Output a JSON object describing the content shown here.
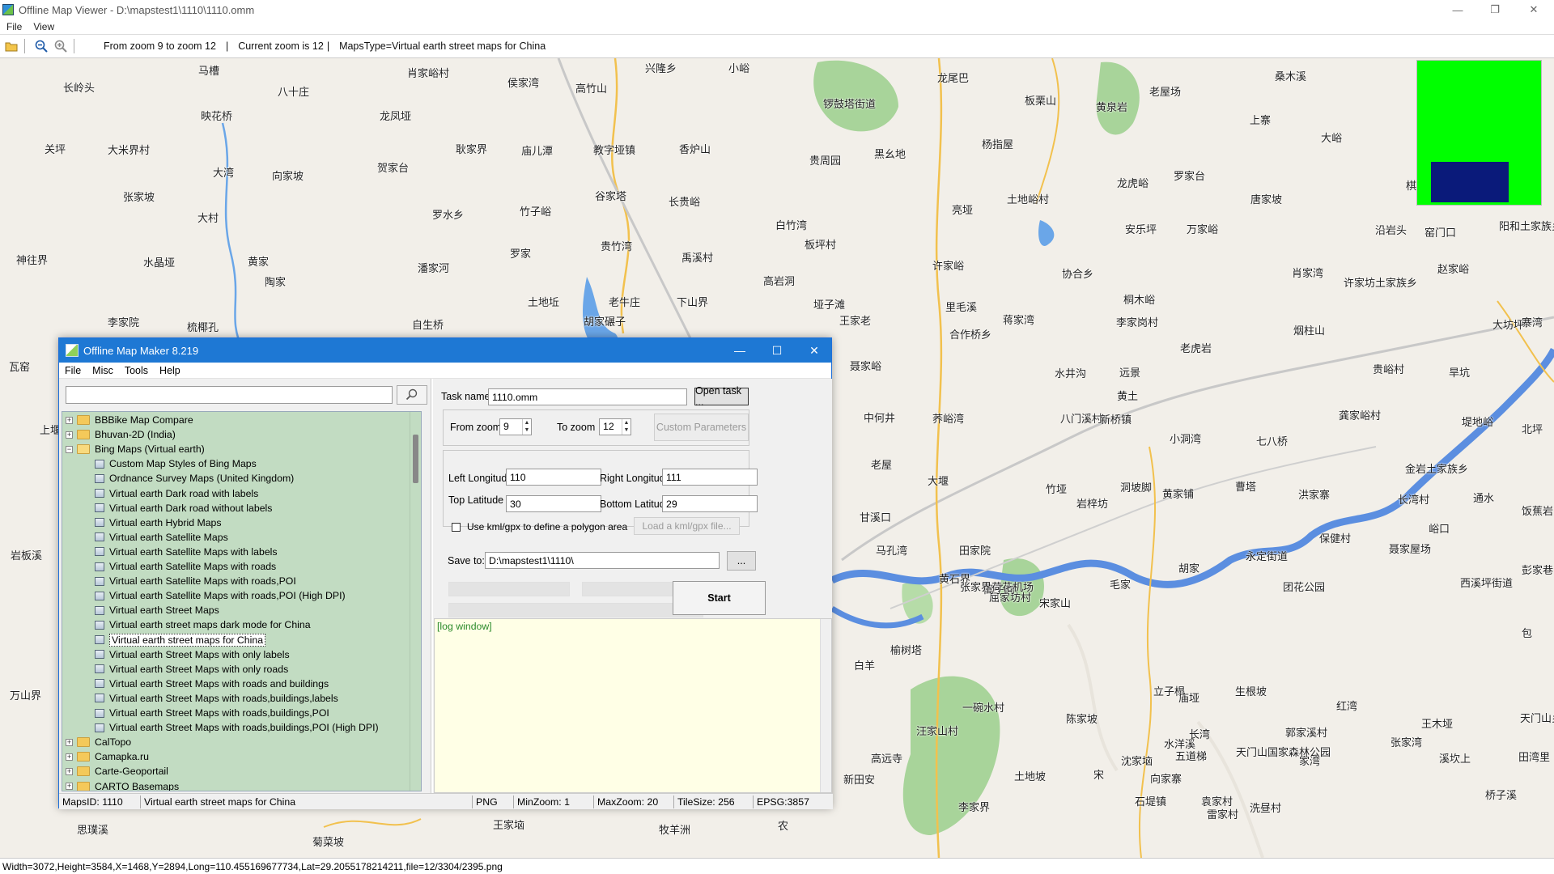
{
  "window": {
    "title": "Offline Map Viewer - D:\\mapstest1\\1110\\1110.omm",
    "controls": {
      "minimize": "—",
      "maximize": "❐",
      "close": "✕"
    }
  },
  "menu": {
    "file": "File",
    "view": "View"
  },
  "toolbar": {
    "zoom_range": "From zoom 9 to zoom 12",
    "current_zoom": "Current zoom is 12",
    "maps_type": "MapsType=Virtual earth street maps for China",
    "separator": "|"
  },
  "statusbar": {
    "text": "Width=3072,Height=3584,X=1468,Y=2894,Long=110.455169677734,Lat=29.2055178214211,file=12/3304/2395.png"
  },
  "colors": {
    "minimap_bg": "#00ff00",
    "minimap_viewport": "#0a1a7a",
    "tree_bg": "#c2dcc2",
    "log_bg": "#ffffe6",
    "dialog_title": "#1e78d4"
  },
  "map_labels": [
    "马槽",
    "肖家峪村",
    "侯家湾",
    "高竹山",
    "兴隆乡",
    "小峪",
    "龙尾巴",
    "长岭头",
    "八十庄",
    "锣鼓塔街道",
    "板栗山",
    "黄泉岩",
    "老屋场",
    "桑木溪",
    "上寨",
    "雷",
    "映花桥",
    "龙凤垭",
    "关坪",
    "大米界村",
    "耿家界",
    "庙儿潭",
    "教字垭镇",
    "香炉山",
    "贵周园",
    "黑幺地",
    "杨指屋",
    "大峪",
    "大湾",
    "向家坡",
    "贺家台",
    "龙虎峪",
    "罗家台",
    "棋盘村",
    "张家坡",
    "谷家塔",
    "长贵峪",
    "土地峪村",
    "唐家坡",
    "罗水乡",
    "竹子峪",
    "亮垭",
    "安乐坪",
    "万家峪",
    "大村",
    "白竹湾",
    "沿岩头",
    "窑门口",
    "阳和土家族乡",
    "神往界",
    "水晶垭",
    "黄家",
    "潘家河",
    "罗家",
    "贵竹湾",
    "禹溪村",
    "板坪村",
    "许家峪",
    "协合乡",
    "肖家湾",
    "赵家峪",
    "陶家",
    "高岩洞",
    "土地坵",
    "老牛庄",
    "下山界",
    "垭子滩",
    "里毛溪",
    "桐木峪",
    "许家坊土家族乡",
    "李家院",
    "梳椰孔",
    "自生桥",
    "胡家碾子",
    "王家老",
    "蒋家湾",
    "李家岗村",
    "大坊坪",
    "寨湾",
    "瓦窑",
    "烟柱山",
    "老虎岩",
    "合作桥乡",
    "聂家峪",
    "水井沟",
    "远景",
    "贵峪村",
    "旱坑",
    "上堰溃",
    "黄土",
    "中何井",
    "荞峪湾",
    "八门溪村",
    "新桥镇",
    "小洞湾",
    "七八桥",
    "龚家峪村",
    "堤地峪",
    "北坪",
    "岩板溪",
    "老屋",
    "金岩土家族乡",
    "大堰",
    "竹垭",
    "岩梓坊",
    "洞坡脚",
    "黄家铺",
    "曹塔",
    "洪家寨",
    "长湾村",
    "通水",
    "饭蕉岩",
    "甘溪口",
    "峪口",
    "马孔湾",
    "田家院",
    "屈家坊村",
    "宋家山",
    "毛家",
    "胡家",
    "永定街道",
    "团花公园",
    "保健村",
    "聂家屋场",
    "西溪坪街道",
    "彭家巷",
    "榆树塔",
    "黄石界",
    "篙子岗",
    "张家界荷花机场",
    "白羊",
    "包",
    "万山界",
    "立子榻",
    "庙垭",
    "生根坡",
    "红湾",
    "王木垭",
    "天门山乡",
    "一碗水村",
    "沈家垴",
    "水洋溪",
    "长湾",
    "郭家溪村",
    "家湾",
    "高远寺",
    "田湾里",
    "张家湾",
    "汪家山村",
    "陈家坡",
    "土地坡",
    "宋",
    "向家寨",
    "五道梯",
    "天门山国家森林公园",
    "溪坎上",
    "新田安",
    "李家界",
    "石堤镇",
    "洗昼村",
    "桥子溪",
    "袁家村",
    "雷家村",
    "思璞溪",
    "菊菜坡",
    "王家垴",
    "牧羊洲",
    "农"
  ],
  "dialog": {
    "title": "Offline Map Maker 8.219",
    "menu": [
      "File",
      "Misc",
      "Tools",
      "Help"
    ],
    "search_placeholder": "",
    "tree": [
      {
        "label": "BBBike Map Compare",
        "type": "folder",
        "expander": "+"
      },
      {
        "label": "Bhuvan-2D (India)",
        "type": "folder",
        "expander": "+"
      },
      {
        "label": "Bing Maps (Virtual earth)",
        "type": "folder-open",
        "expander": "−"
      },
      {
        "label": "Custom Map Styles of Bing Maps",
        "type": "map"
      },
      {
        "label": "Ordnance Survey Maps (United Kingdom)",
        "type": "map"
      },
      {
        "label": "Virtual earth Dark road with labels",
        "type": "map"
      },
      {
        "label": "Virtual earth Dark road without labels",
        "type": "map"
      },
      {
        "label": "Virtual earth Hybrid Maps",
        "type": "map"
      },
      {
        "label": "Virtual earth Satellite Maps",
        "type": "map"
      },
      {
        "label": "Virtual earth Satellite Maps with labels",
        "type": "map"
      },
      {
        "label": "Virtual earth Satellite Maps with roads",
        "type": "map"
      },
      {
        "label": "Virtual earth Satellite Maps with roads,POI",
        "type": "map"
      },
      {
        "label": "Virtual earth Satellite Maps with roads,POI (High DPI)",
        "type": "map"
      },
      {
        "label": "Virtual earth Street Maps",
        "type": "map"
      },
      {
        "label": "Virtual earth street maps dark mode for China",
        "type": "map"
      },
      {
        "label": "Virtual earth street maps for China",
        "type": "map",
        "selected": true
      },
      {
        "label": "Virtual earth Street Maps with only labels",
        "type": "map"
      },
      {
        "label": "Virtual earth Street Maps with only roads",
        "type": "map"
      },
      {
        "label": "Virtual earth Street Maps with roads and buildings",
        "type": "map"
      },
      {
        "label": "Virtual earth Street Maps with roads,buildings,labels",
        "type": "map"
      },
      {
        "label": "Virtual earth Street Maps with roads,buildings,POI",
        "type": "map"
      },
      {
        "label": "Virtual earth Street Maps with roads,buildings,POI (High DPI)",
        "type": "map"
      },
      {
        "label": "CalTopo",
        "type": "folder",
        "expander": "+"
      },
      {
        "label": "Camapka.ru",
        "type": "folder",
        "expander": "+"
      },
      {
        "label": "Carte-Geoportail",
        "type": "folder",
        "expander": "+"
      },
      {
        "label": "CARTO Basemaps",
        "type": "folder",
        "expander": "+"
      }
    ],
    "task_name_label": "Task name",
    "task_name_value": "1110.omm",
    "open_task": "Open task ...",
    "from_zoom_label": "From zoom",
    "from_zoom_value": "9",
    "to_zoom_label": "To zoom",
    "to_zoom_value": "12",
    "custom_params": "Custom Parameters",
    "left_lon_label": "Left Longitude",
    "left_lon_value": "110",
    "right_lon_label": "Right Longitude",
    "right_lon_value": "111",
    "top_lat_label": "Top Latitude",
    "top_lat_value": "30",
    "bottom_lat_label": "Bottom Latitude",
    "bottom_lat_value": "29",
    "kml_check_label": "Use kml/gpx to define a polygon area",
    "load_kml": "Load a kml/gpx file...",
    "save_to_label": "Save to:",
    "save_to_value": "D:\\mapstest1\\1110\\",
    "browse": "...",
    "start": "Start",
    "log_text": "[log window]",
    "status": {
      "maps_id": "MapsID: 1110",
      "name": "Virtual earth street maps for China",
      "format": "PNG",
      "min_zoom": "MinZoom: 1",
      "max_zoom": "MaxZoom: 20",
      "tile_size": "TileSize: 256",
      "epsg": "EPSG:3857"
    }
  }
}
